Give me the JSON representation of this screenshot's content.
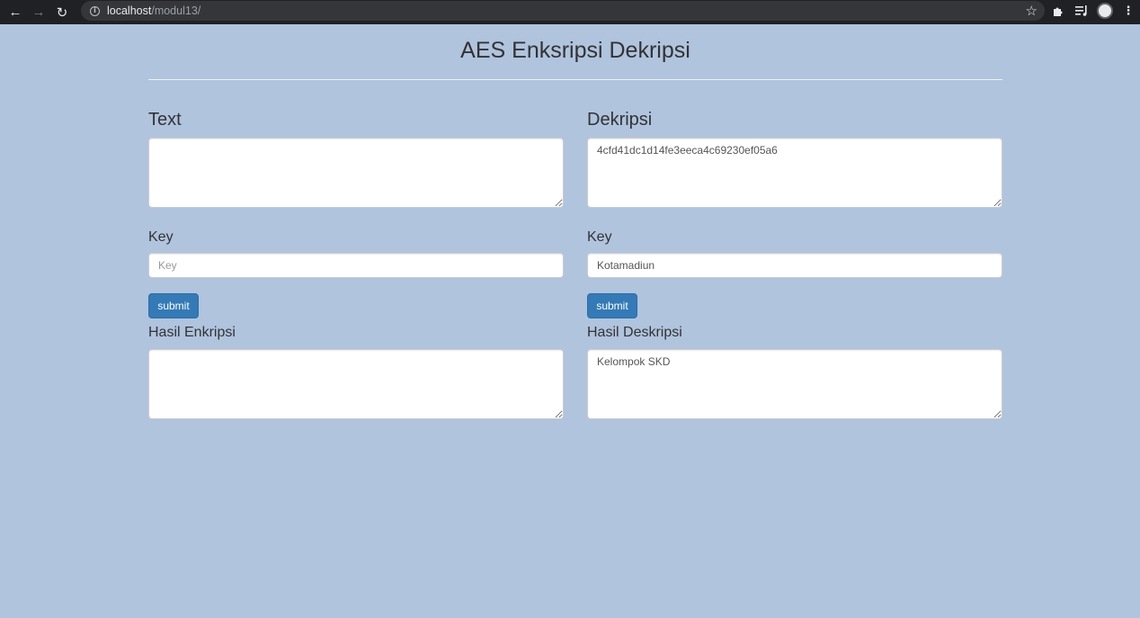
{
  "browser": {
    "url_host": "localhost",
    "url_path": "/modul13/",
    "icons": [
      "back-icon",
      "forward-icon",
      "reload-icon",
      "info-icon",
      "star-icon",
      "extensions-icon",
      "reading-list-icon",
      "profile-avatar",
      "menu-icon"
    ]
  },
  "page": {
    "title": "AES Enksripsi Dekripsi"
  },
  "encrypt": {
    "heading": "Text",
    "text_value": "",
    "key_label": "Key",
    "key_value": "",
    "key_placeholder": "Key",
    "submit_label": "submit",
    "result_label": "Hasil Enkripsi",
    "result_value": ""
  },
  "decrypt": {
    "heading": "Dekripsi",
    "text_value": "4cfd41dc1d14fe3eeca4c69230ef05a6",
    "key_label": "Key",
    "key_value": "Kotamadiun",
    "submit_label": "submit",
    "result_label": "Hasil Deskripsi",
    "result_value": "Kelompok SKD"
  },
  "colors": {
    "page_background": "#b0c4de",
    "button_primary": "#337ab7"
  }
}
